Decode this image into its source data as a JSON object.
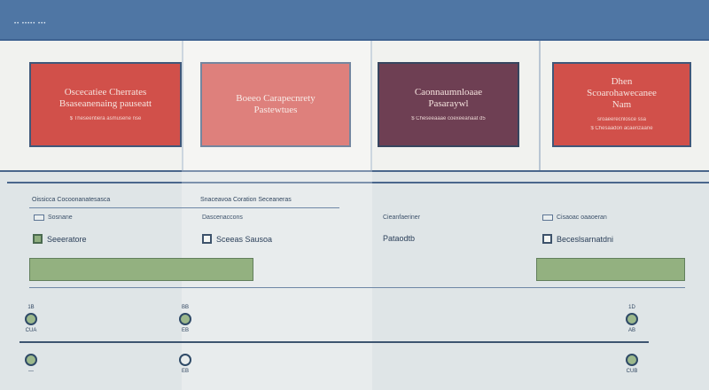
{
  "titlebar": {
    "title": "•• ••••• •••"
  },
  "cards": [
    {
      "lines": [
        "Oscecatiee Cherrates",
        "Bsaseanenaing pauseatt"
      ],
      "sub": "$ Theseentiera asmusene nse"
    },
    {
      "lines": [
        "Boeeo Carapecnrety",
        "Pastewtues"
      ],
      "sub": ""
    },
    {
      "lines": [
        "Caonnaumnloaae",
        "Pasaraywl"
      ],
      "sub": "$ Cheseeaaae coexeeanaat d5"
    },
    {
      "lines": [
        "Dhen",
        "Scoarohawecanee",
        "Nam"
      ],
      "sub": "sroaeerecnlosce ssa",
      "sub2": "$ Chesaadon acaenzaane"
    }
  ],
  "table": {
    "headers": [
      "Oissicca Cocoonanatesasca",
      "Snaceavoa Coration Seceaneras"
    ],
    "check_labels": [
      "Sosnane",
      "Dascenaccons",
      "Cieanfaeriner",
      "Cisaoac oaaoeran"
    ],
    "options": [
      "Seeeratore",
      "Sceeas Sausoa",
      "Pataodtb",
      "Beceslsarnatdni"
    ]
  },
  "timeline": {
    "nodes": [
      {
        "top": "1B",
        "bottom": "CUA"
      },
      {
        "top": "BB",
        "bottom": "EB"
      },
      {
        "top": "1D",
        "bottom": "AB"
      }
    ],
    "lower_nodes": [
      {
        "bottom": "—"
      },
      {
        "bottom": "EB"
      },
      {
        "bottom": "CUB"
      }
    ]
  }
}
